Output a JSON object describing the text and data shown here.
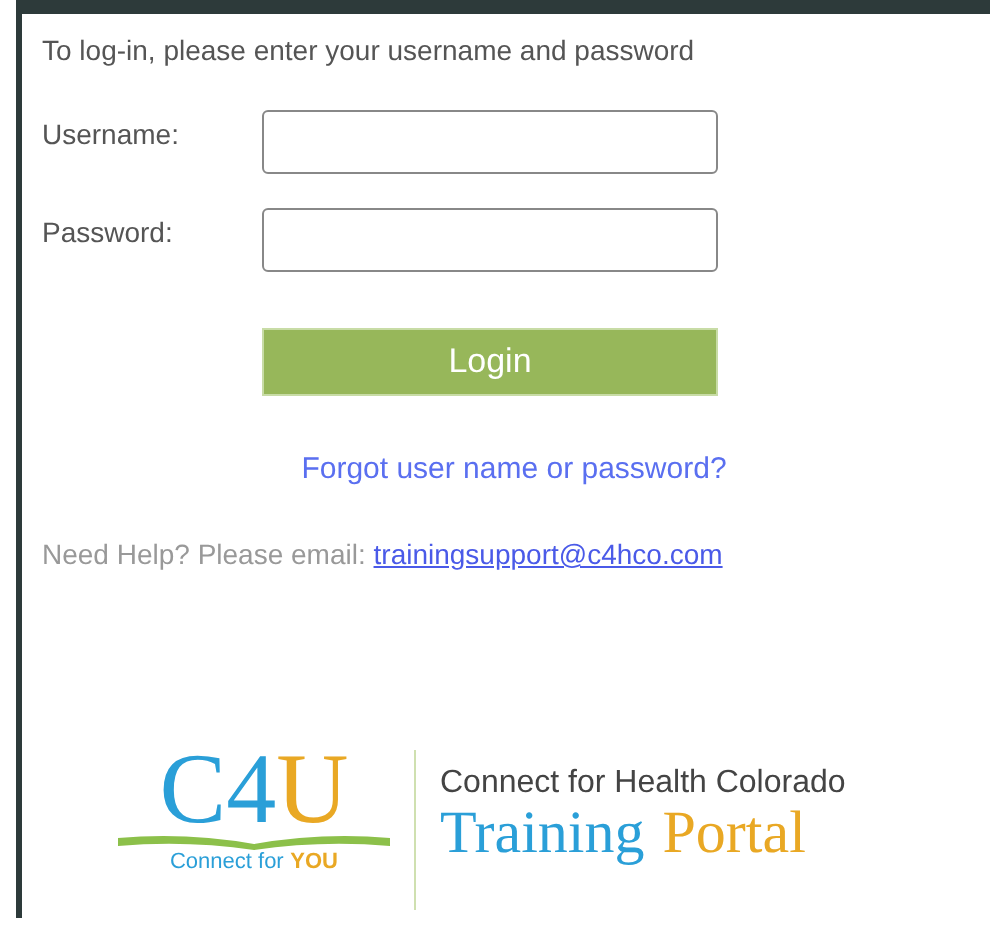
{
  "intro": "To log-in, please enter your username and password",
  "fields": [
    {
      "label": "Username:"
    },
    {
      "label": "Password:"
    }
  ],
  "login_button": "Login",
  "forgot_link": "Forgot user name or password?",
  "help": {
    "text": "Need Help? Please email:",
    "email": "trainingsupport@c4hco.com"
  },
  "logo": {
    "mark": [
      {
        "text": "C4",
        "color": "#2a9fd8"
      },
      {
        "text": "U",
        "color": "#e9a824"
      }
    ],
    "tagline": [
      {
        "text": "Connect for",
        "color": "#2a9fd8"
      },
      {
        "text": "YOU",
        "color": "#e9a824"
      }
    ],
    "org": "Connect for Health Colorado",
    "title": [
      {
        "text": "Training",
        "color": "#2a9fd8"
      },
      {
        "text": "Portal",
        "color": "#e9a824"
      }
    ]
  }
}
